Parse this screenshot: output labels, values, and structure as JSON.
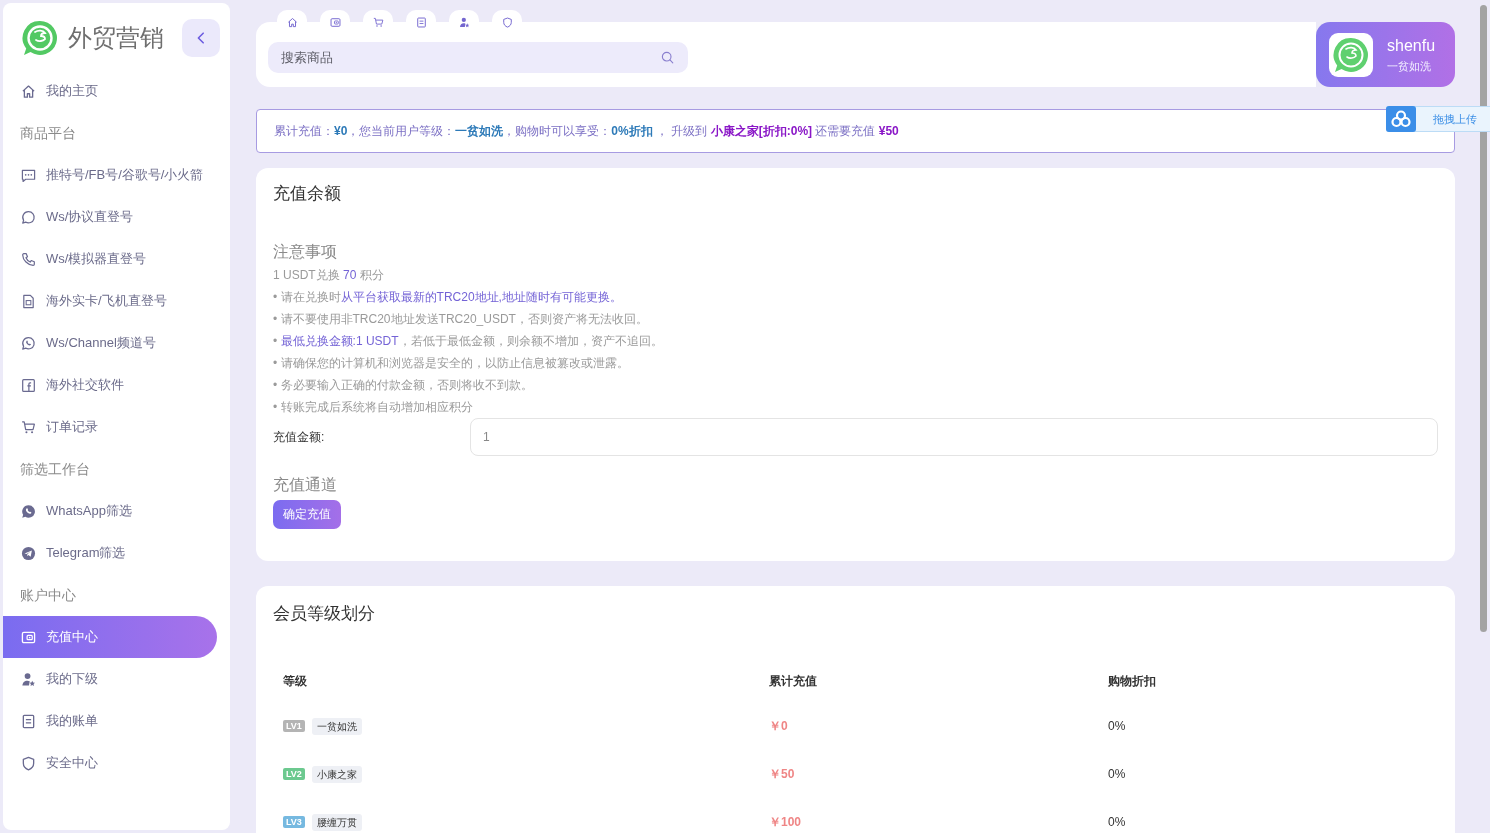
{
  "sidebar": {
    "brand": "外贸营销",
    "sections": [
      {
        "items": [
          {
            "label": "我的主页",
            "selected": false
          }
        ]
      },
      {
        "heading": "商品平台",
        "items": [
          {
            "label": "推特号/FB号/谷歌号/小火箭",
            "selected": false
          },
          {
            "label": "Ws/协议直登号",
            "selected": false
          },
          {
            "label": "Ws/模拟器直登号",
            "selected": false
          },
          {
            "label": "海外实卡/飞机直登号",
            "selected": false
          },
          {
            "label": "Ws/Channel频道号",
            "selected": false
          },
          {
            "label": "海外社交软件",
            "selected": false
          },
          {
            "label": "订单记录",
            "selected": false
          }
        ]
      },
      {
        "heading": "筛选工作台",
        "items": [
          {
            "label": "WhatsApp筛选",
            "selected": false
          },
          {
            "label": "Telegram筛选",
            "selected": false
          }
        ]
      },
      {
        "heading": "账户中心",
        "items": [
          {
            "label": "充值中心",
            "selected": true
          },
          {
            "label": "我的下级",
            "selected": false
          },
          {
            "label": "我的账单",
            "selected": false
          },
          {
            "label": "安全中心",
            "selected": false
          }
        ]
      }
    ]
  },
  "search": {
    "placeholder": "搜索商品"
  },
  "user": {
    "name": "shenfu",
    "rank": "一贫如洗"
  },
  "upload": {
    "label": "拖拽上传"
  },
  "notice": {
    "segments": [
      {
        "text": "累计充值：",
        "kind": "plain"
      },
      {
        "text": "¥0",
        "kind": "value"
      },
      {
        "text": "，您当前用户等级：",
        "kind": "plain"
      },
      {
        "text": "一贫如洗",
        "kind": "value"
      },
      {
        "text": "，购物时可以享受：",
        "kind": "plain"
      },
      {
        "text": "0%折扣",
        "kind": "value"
      },
      {
        "text": " ， 升级到 ",
        "kind": "plain"
      },
      {
        "text": "小康之家[折扣:0%]",
        "kind": "target"
      },
      {
        "text": " 还需要充值 ",
        "kind": "plain"
      },
      {
        "text": "¥50",
        "kind": "target"
      }
    ]
  },
  "recharge": {
    "title": "充值余额",
    "notes_title": "注意事项",
    "rate": [
      {
        "text": "1 USDT兑换 ",
        "kind": "plain"
      },
      {
        "text": "70",
        "kind": "highlight"
      },
      {
        "text": " 积分",
        "kind": "plain"
      }
    ],
    "notes": [
      {
        "segments": [
          {
            "text": "• 请在兑换时",
            "kind": "plain"
          },
          {
            "text": "从平台获取最新的TRC20地址,地址随时有可能更换。",
            "kind": "highlight"
          }
        ]
      },
      {
        "segments": [
          {
            "text": "• 请不要使用非TRC20地址发送TRC20_USDT，否则资产将无法收回。",
            "kind": "plain"
          }
        ]
      },
      {
        "segments": [
          {
            "text": "• ",
            "kind": "plain"
          },
          {
            "text": "最低兑换金额:1 USDT",
            "kind": "highlight"
          },
          {
            "text": "，若低于最低金额，则余额不增加，资产不追回。",
            "kind": "plain"
          }
        ]
      },
      {
        "segments": [
          {
            "text": "• 请确保您的计算机和浏览器是安全的，以防止信息被篡改或泄露。",
            "kind": "plain"
          }
        ]
      },
      {
        "segments": [
          {
            "text": "• 务必要输入正确的付款金额，否则将收不到款。",
            "kind": "plain"
          }
        ]
      },
      {
        "segments": [
          {
            "text": "• 转账完成后系统将自动增加相应积分",
            "kind": "plain"
          }
        ]
      }
    ],
    "amount_label": "充值金额:",
    "amount": "1",
    "channel_title": "充值通道",
    "submit": "确定充值"
  },
  "levels": {
    "title": "会员等级划分",
    "columns": [
      "等级",
      "累计充值",
      "购物折扣"
    ],
    "rows": [
      {
        "badge": "LV1",
        "color": "#b4b4b4",
        "name": "一贫如洗",
        "total": "￥0",
        "discount": "0%"
      },
      {
        "badge": "LV2",
        "color": "#6cc98f",
        "name": "小康之家",
        "total": "￥50",
        "discount": "0%"
      },
      {
        "badge": "LV3",
        "color": "#76b9e0",
        "name": "腰缠万贯",
        "total": "￥100",
        "discount": "0%"
      }
    ]
  }
}
